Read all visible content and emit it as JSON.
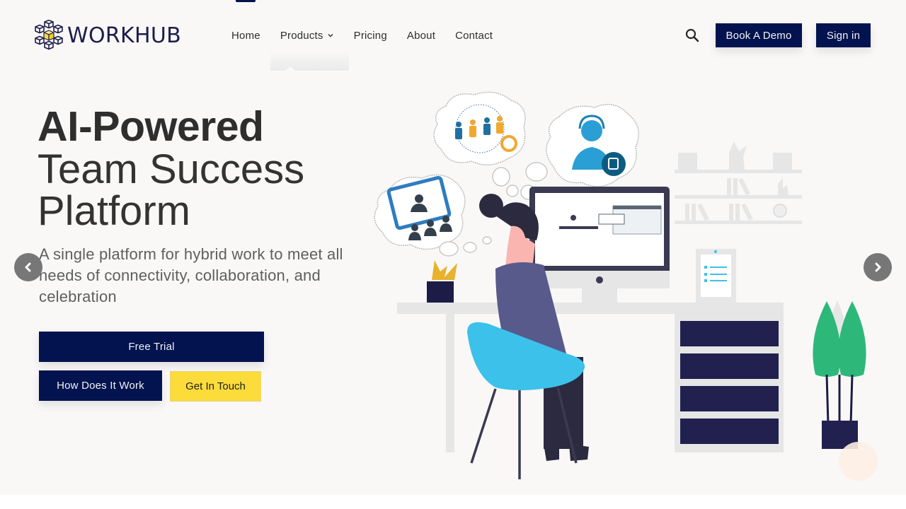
{
  "brand": {
    "name": "WORKHUB",
    "logo_icon": "cube-cluster-icon"
  },
  "nav": {
    "items": [
      {
        "label": "Home",
        "active": true
      },
      {
        "label": "Products",
        "has_dropdown": true
      },
      {
        "label": "Pricing"
      },
      {
        "label": "About"
      },
      {
        "label": "Contact"
      }
    ],
    "search_icon": "search-icon",
    "book_demo_label": "Book A Demo",
    "sign_in_label": "Sign in"
  },
  "hero": {
    "headline_bold": "AI-Powered",
    "headline_line2": "Team Success",
    "headline_line3": "Platform",
    "subtext": "A single platform for hybrid work to meet all needs of connectivity, collaboration, and celebration",
    "free_trial_label": "Free Trial",
    "how_it_works_label": "How Does It Work",
    "get_in_touch_label": "Get In Touch",
    "prev_icon": "chevron-left-icon",
    "next_icon": "chevron-right-icon"
  },
  "illustration": {
    "description": "Woman at desk with computer, thought bubbles showing team, video conference and support agent",
    "thought_bubbles": [
      "team-collaboration-icon",
      "video-conference-icon",
      "support-agent-icon"
    ]
  },
  "colors": {
    "primary": "#02134f",
    "accent_yellow": "#fbdc3b",
    "background": "#f9f8f7",
    "text_dark": "#2e2e2e",
    "text_muted": "#5f5f5f",
    "carousel_arrow": "#777777"
  }
}
